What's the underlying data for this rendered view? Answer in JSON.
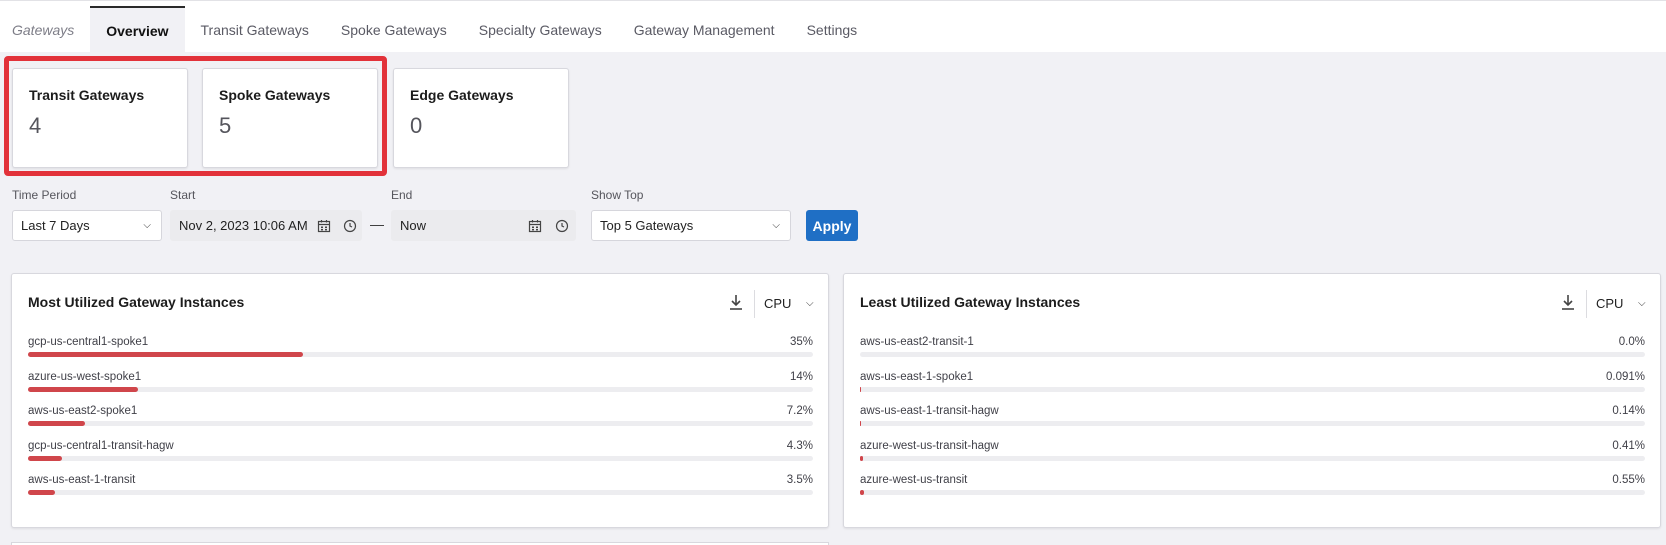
{
  "tabs": {
    "crumb": "Gateways",
    "items": [
      "Overview",
      "Transit Gateways",
      "Spoke Gateways",
      "Specialty Gateways",
      "Gateway Management",
      "Settings"
    ],
    "active": "Overview"
  },
  "cards": [
    {
      "title": "Transit Gateways",
      "value": "4"
    },
    {
      "title": "Spoke Gateways",
      "value": "5"
    },
    {
      "title": "Edge Gateways",
      "value": "0"
    }
  ],
  "filters": {
    "time_period_label": "Time Period",
    "time_period_value": "Last 7 Days",
    "start_label": "Start",
    "start_value": "Nov 2, 2023 10:06 AM",
    "separator": "—",
    "end_label": "End",
    "end_value": "Now",
    "show_top_label": "Show Top",
    "show_top_value": "Top 5 Gateways",
    "apply_label": "Apply"
  },
  "most_utilized": {
    "title": "Most Utilized Gateway Instances",
    "metric": "CPU",
    "rows": [
      {
        "name": "gcp-us-central1-spoke1",
        "value": "35%",
        "fraction": 0.35
      },
      {
        "name": "azure-us-west-spoke1",
        "value": "14%",
        "fraction": 0.14
      },
      {
        "name": "aws-us-east2-spoke1",
        "value": "7.2%",
        "fraction": 0.072
      },
      {
        "name": "gcp-us-central1-transit-hagw",
        "value": "4.3%",
        "fraction": 0.043
      },
      {
        "name": "aws-us-east-1-transit",
        "value": "3.5%",
        "fraction": 0.035
      }
    ]
  },
  "least_utilized": {
    "title": "Least Utilized Gateway Instances",
    "metric": "CPU",
    "rows": [
      {
        "name": "aws-us-east2-transit-1",
        "value": "0.0%",
        "fraction": 0.0
      },
      {
        "name": "aws-us-east-1-spoke1",
        "value": "0.091%",
        "fraction": 0.00091
      },
      {
        "name": "aws-us-east-1-transit-hagw",
        "value": "0.14%",
        "fraction": 0.0014
      },
      {
        "name": "azure-west-us-transit-hagw",
        "value": "0.41%",
        "fraction": 0.0041
      },
      {
        "name": "azure-west-us-transit",
        "value": "0.55%",
        "fraction": 0.0055
      }
    ]
  },
  "colors": {
    "accent": "#1f6fc5",
    "bar_fill": "#d0464b",
    "highlight": "#e2323a"
  },
  "icons": {
    "calendar": "calendar-icon",
    "clock": "clock-icon",
    "download": "download-icon",
    "chevron": "chevron-down-icon"
  }
}
